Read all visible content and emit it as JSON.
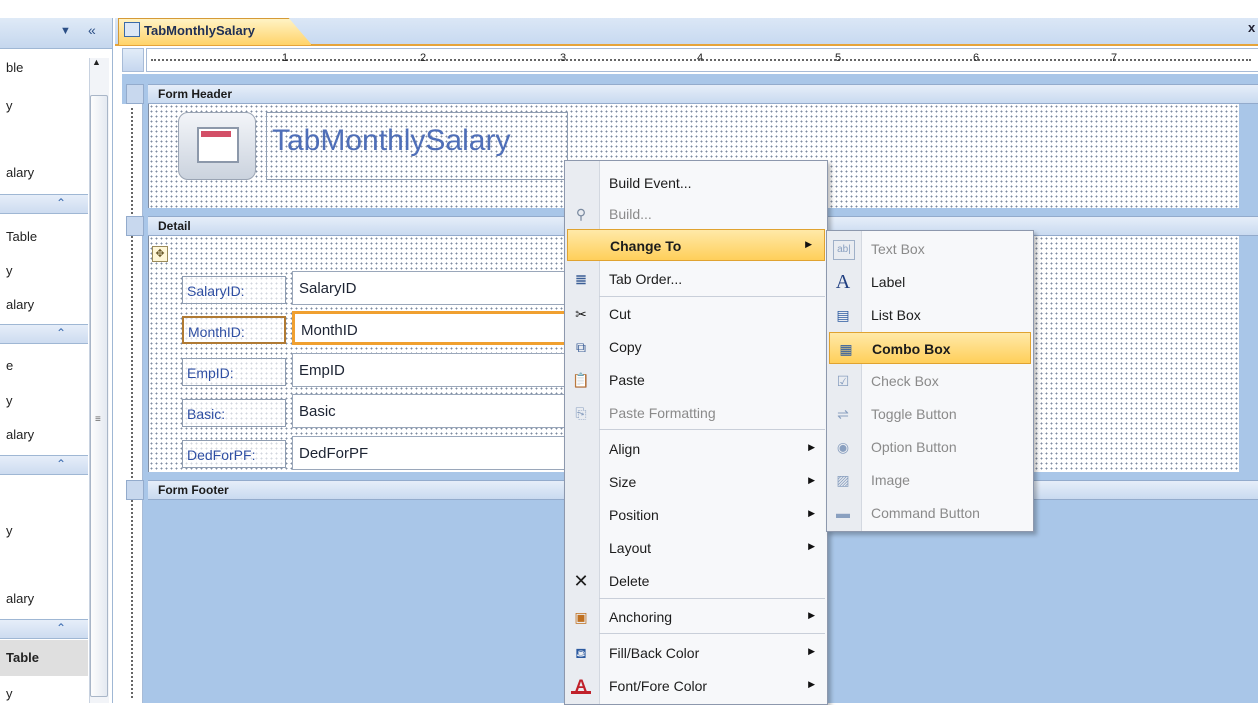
{
  "nav_pane": {
    "header_icons": [
      "chevron-down-icon",
      "double-chevron-left-icon"
    ],
    "items": [
      "ble",
      "y",
      "alary",
      "Table",
      "y",
      "alary",
      "e",
      "y",
      "alary",
      "y",
      "alary",
      "Table",
      "y"
    ],
    "group_icon": "double-chevron-up-icon"
  },
  "doc_tab": {
    "title": "TabMonthlySalary",
    "close_glyph": "x"
  },
  "ruler": {
    "numbers": [
      "1",
      "2",
      "3",
      "4",
      "5",
      "6",
      "7"
    ]
  },
  "bands": {
    "form_header": "Form Header",
    "detail": "Detail",
    "form_footer": "Form Footer"
  },
  "form_title": "TabMonthlySalary",
  "fields": [
    {
      "label": "SalaryID:",
      "value": "SalaryID"
    },
    {
      "label": "MonthID:",
      "value": "MonthID"
    },
    {
      "label": "EmpID:",
      "value": "EmpID"
    },
    {
      "label": "Basic:",
      "value": "Basic"
    },
    {
      "label": "DedForPF:",
      "value": "DedForPF"
    }
  ],
  "context_menu": {
    "items": [
      {
        "label": "Build Event...",
        "icon": "",
        "disabled": false,
        "submenu": false
      },
      {
        "label": "Build...",
        "icon": "build-wand-icon",
        "disabled": true,
        "submenu": false
      },
      {
        "label": "Change To",
        "icon": "",
        "disabled": false,
        "submenu": true,
        "highlighted": true
      },
      {
        "label": "Tab Order...",
        "icon": "tab-order-icon",
        "disabled": false,
        "submenu": false
      },
      {
        "label": "Cut",
        "icon": "scissors-icon",
        "disabled": false,
        "submenu": false
      },
      {
        "label": "Copy",
        "icon": "copy-icon",
        "disabled": false,
        "submenu": false
      },
      {
        "label": "Paste",
        "icon": "paste-icon",
        "disabled": false,
        "submenu": false
      },
      {
        "label": "Paste Formatting",
        "icon": "paste-formatting-icon",
        "disabled": true,
        "submenu": false
      },
      {
        "label": "Align",
        "icon": "",
        "disabled": false,
        "submenu": true
      },
      {
        "label": "Size",
        "icon": "",
        "disabled": false,
        "submenu": true
      },
      {
        "label": "Position",
        "icon": "",
        "disabled": false,
        "submenu": true
      },
      {
        "label": "Layout",
        "icon": "",
        "disabled": false,
        "submenu": true
      },
      {
        "label": "Delete",
        "icon": "delete-x-icon",
        "disabled": false,
        "submenu": false
      },
      {
        "label": "Anchoring",
        "icon": "anchoring-icon",
        "disabled": false,
        "submenu": true
      },
      {
        "label": "Fill/Back Color",
        "icon": "fill-color-icon",
        "disabled": false,
        "submenu": true
      },
      {
        "label": "Font/Fore Color",
        "icon": "font-color-icon",
        "disabled": false,
        "submenu": true
      }
    ]
  },
  "submenu": {
    "items": [
      {
        "label": "Text Box",
        "icon": "textbox-icon",
        "disabled": true
      },
      {
        "label": "Label",
        "icon": "label-icon",
        "disabled": false
      },
      {
        "label": "List Box",
        "icon": "listbox-icon",
        "disabled": false
      },
      {
        "label": "Combo Box",
        "icon": "combobox-icon",
        "disabled": false,
        "highlighted": true
      },
      {
        "label": "Check Box",
        "icon": "checkbox-icon",
        "disabled": true
      },
      {
        "label": "Toggle Button",
        "icon": "toggle-button-icon",
        "disabled": true
      },
      {
        "label": "Option Button",
        "icon": "option-button-icon",
        "disabled": true
      },
      {
        "label": "Image",
        "icon": "image-icon",
        "disabled": true
      },
      {
        "label": "Command Button",
        "icon": "command-button-icon",
        "disabled": true
      }
    ]
  },
  "colors": {
    "highlight": "#ffcf5a",
    "tab_accent": "#e6a43a",
    "design_bg": "#a9c6e8",
    "label_text": "#2f4fa3"
  }
}
